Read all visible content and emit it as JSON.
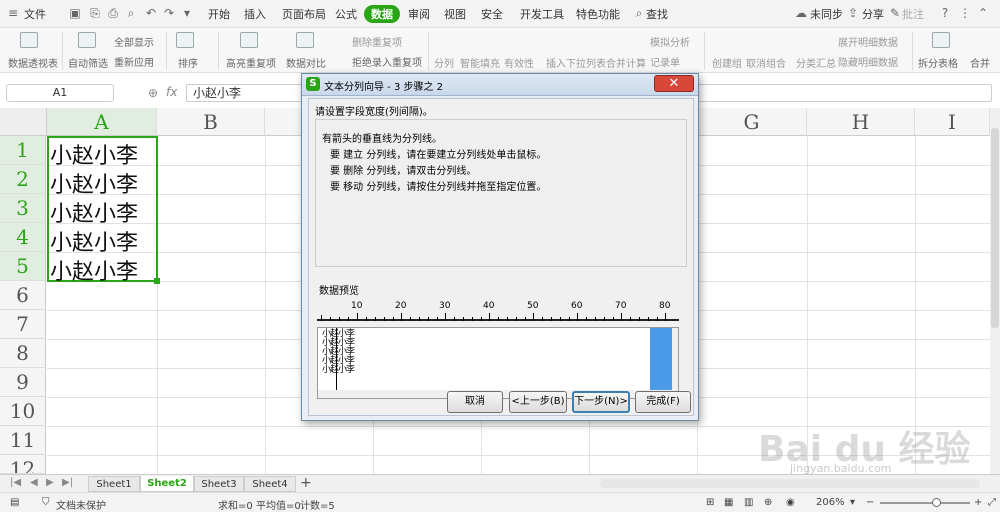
{
  "menubar": {
    "file_label": "文件",
    "tabs": [
      "开始",
      "插入",
      "页面布局",
      "公式",
      "数据",
      "审阅",
      "视图",
      "安全",
      "开发工具",
      "特色功能"
    ],
    "active_tab": "数据",
    "search_label": "查找",
    "sync_label": "未同步",
    "share_label": "分享",
    "comment_label": "批注"
  },
  "ribbon": {
    "items": [
      "数据透视表",
      "自动筛选",
      "全部显示",
      "重新应用",
      "排序",
      "高亮重复项",
      "删除重复项",
      "拒绝录入重复项",
      "数据对比",
      "分列",
      "智能填充",
      "有效性",
      "插入下拉列表",
      "合并计算",
      "模拟分析",
      "记录单",
      "创建组",
      "取消组合",
      "分类汇总",
      "展开明细数据",
      "隐藏明细数据",
      "拆分表格",
      "合并"
    ]
  },
  "formula": {
    "cell_ref": "A1",
    "fx": "fx",
    "content": "小赵小李"
  },
  "grid": {
    "columns": [
      "A",
      "B",
      "C",
      "D",
      "E",
      "F",
      "G",
      "H",
      "I"
    ],
    "rows": [
      "1",
      "2",
      "3",
      "4",
      "5",
      "6",
      "7",
      "8",
      "9",
      "10",
      "11",
      "12"
    ],
    "cells": [
      "小赵小李",
      "小赵小李",
      "小赵小李",
      "小赵小李",
      "小赵小李"
    ]
  },
  "sheets": {
    "tabs": [
      "Sheet1",
      "Sheet2",
      "Sheet3",
      "Sheet4"
    ],
    "active": "Sheet2",
    "add": "+"
  },
  "status": {
    "protect": "文档未保护",
    "sum": "求和=0",
    "avg": "平均值=0",
    "count": "计数=5",
    "zoom": "206%"
  },
  "dialog": {
    "title": "文本分列向导 - 3 步骤之 2",
    "instruction": "请设置字段宽度(列间隔)。",
    "line1": "有箭头的垂直线为分列线。",
    "line2": "要 建立 分列线，请在要建立分列线处单击鼠标。",
    "line3": "要 删除 分列线，请双击分列线。",
    "line4": "要 移动 分列线，请按住分列线并拖至指定位置。",
    "preview_label": "数据预览",
    "ruler": [
      "10",
      "20",
      "30",
      "40",
      "50",
      "60",
      "70",
      "80"
    ],
    "preview_lines": [
      "小赵小李",
      "小赵小李",
      "小赵小李",
      "小赵小李",
      "小赵小李"
    ],
    "buttons": {
      "cancel": "取消",
      "back": "<上一步(B)",
      "next": "下一步(N)>",
      "finish": "完成(F)"
    },
    "close": "✕"
  },
  "watermark": {
    "brand": "Bai du 经验",
    "url": "jingyan.baidu.com"
  },
  "colors": {
    "accent": "#2aa515",
    "selection": "#217346",
    "dialog_close": "#d9473b"
  }
}
